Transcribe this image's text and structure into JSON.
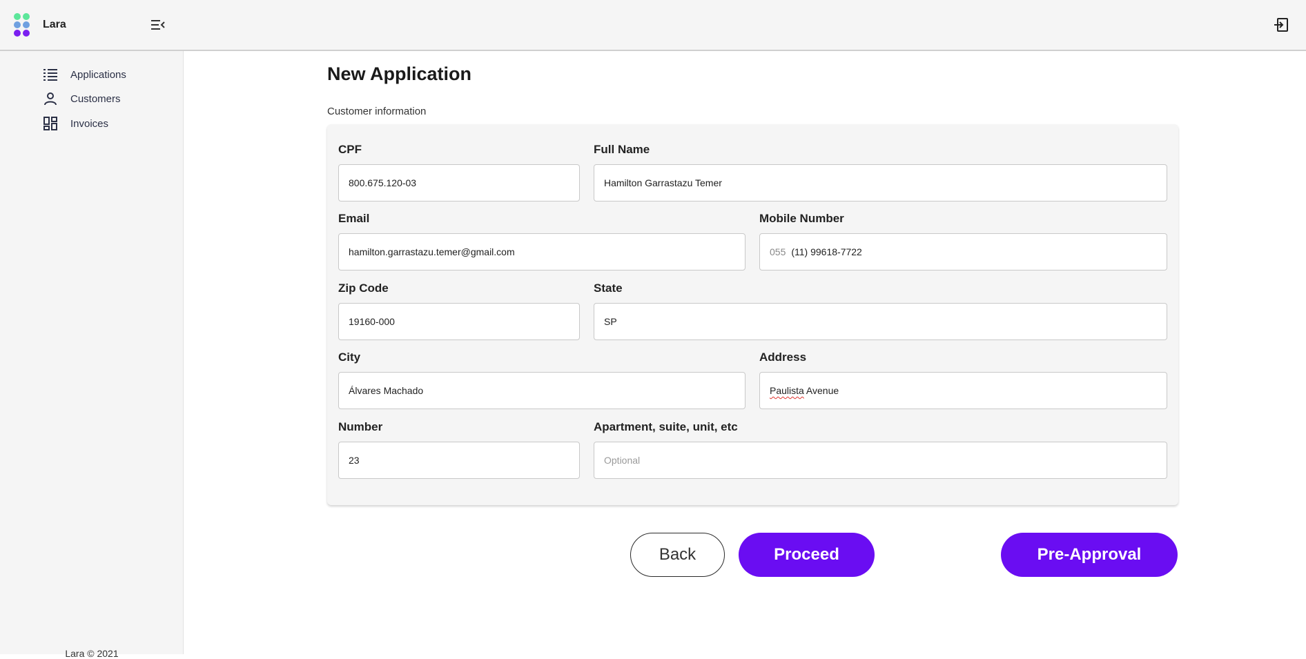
{
  "app": {
    "name": "Lara",
    "footer": "Lara © 2021",
    "logo_colors": [
      "#5ce69a",
      "#5ce69a",
      "#6fa0e0",
      "#6fa0e0",
      "#7b1ff0",
      "#7b1ff0"
    ],
    "accent": "#6a0df2"
  },
  "header": {
    "menu_icon": "menu-collapse-icon",
    "logout_icon": "logout-icon"
  },
  "sidebar": {
    "items": [
      {
        "label": "Applications",
        "icon": "list-icon"
      },
      {
        "label": "Customers",
        "icon": "person-icon"
      },
      {
        "label": "Invoices",
        "icon": "dashboard-icon"
      }
    ]
  },
  "main": {
    "title": "New Application",
    "section_label": "Customer information",
    "fields": {
      "cpf": {
        "label": "CPF",
        "value": "800.675.120-03"
      },
      "full_name": {
        "label": "Full Name",
        "value": "Hamilton Garrastazu Temer"
      },
      "email": {
        "label": "Email",
        "value": "hamilton.garrastazu.temer@gmail.com"
      },
      "mobile": {
        "label": "Mobile Number",
        "prefix": "055",
        "value": "(11) 99618-7722"
      },
      "zip": {
        "label": "Zip Code",
        "value": "19160-000"
      },
      "state": {
        "label": "State",
        "value": "SP"
      },
      "city": {
        "label": "City",
        "value": "Álvares Machado"
      },
      "address": {
        "label": "Address",
        "value_word1": "Paulista",
        "value_word2": " Avenue"
      },
      "number": {
        "label": "Number",
        "value": "23"
      },
      "apartment": {
        "label": "Apartment, suite, unit, etc",
        "value": "",
        "placeholder": "Optional"
      }
    },
    "buttons": {
      "back": "Back",
      "proceed": "Proceed",
      "pre_approval": "Pre-Approval"
    }
  }
}
